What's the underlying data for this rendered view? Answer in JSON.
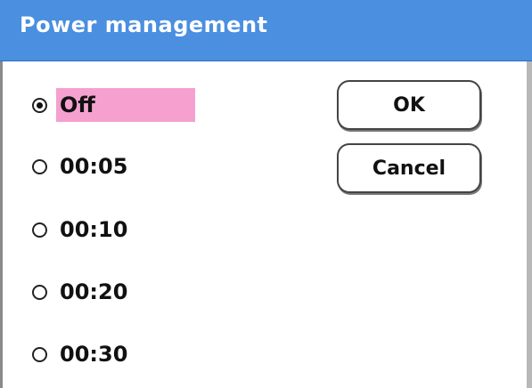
{
  "dialog": {
    "title": "Power management"
  },
  "options": [
    {
      "label": "Off",
      "selected": true
    },
    {
      "label": "00:05",
      "selected": false
    },
    {
      "label": "00:10",
      "selected": false
    },
    {
      "label": "00:20",
      "selected": false
    },
    {
      "label": "00:30",
      "selected": false
    }
  ],
  "buttons": {
    "ok_label": "OK",
    "cancel_label": "Cancel"
  },
  "colors": {
    "titlebar": "#4a8fe0",
    "selected_highlight": "#f5a0cf"
  }
}
